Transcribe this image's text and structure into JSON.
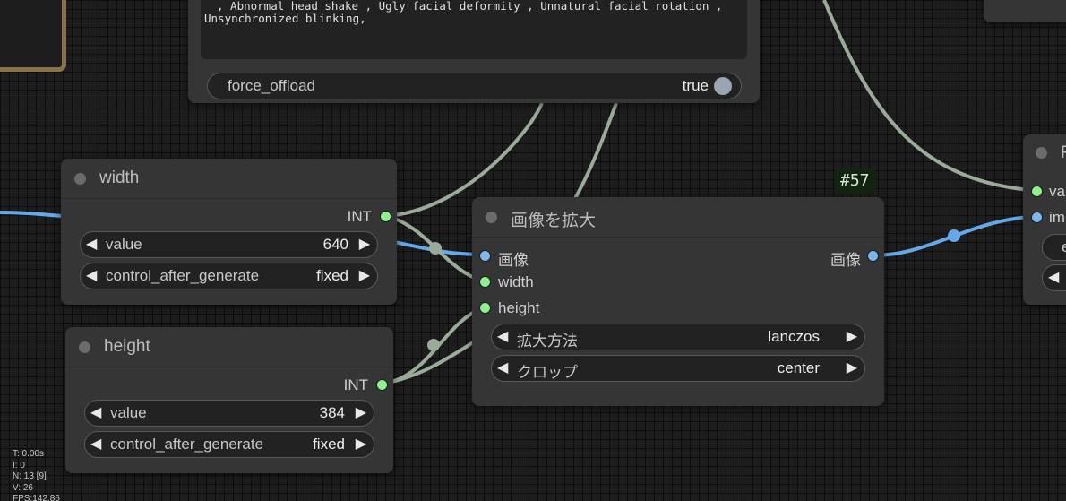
{
  "top_node": {
    "text_line1": ", Abnormal head shake , Ugly facial deformity , Unnatural facial rotation ,",
    "text_line2": "Unsynchronized blinking,",
    "toggle_label": "force_offload",
    "toggle_value": "true"
  },
  "width_node": {
    "title": "width",
    "output_type": "INT",
    "widgets": [
      {
        "name": "value",
        "value": "640"
      },
      {
        "name": "control_after_generate",
        "value": "fixed"
      }
    ]
  },
  "height_node": {
    "title": "height",
    "output_type": "INT",
    "widgets": [
      {
        "name": "value",
        "value": "384"
      },
      {
        "name": "control_after_generate",
        "value": "fixed"
      }
    ]
  },
  "upscale_node": {
    "badge": "#57",
    "title": "画像を拡大",
    "inputs": [
      "画像",
      "width",
      "height"
    ],
    "output_label": "画像",
    "widgets": [
      {
        "name": "拡大方法",
        "value": "lanczos"
      },
      {
        "name": "クロップ",
        "value": "center"
      }
    ]
  },
  "right_node": {
    "inputs": [
      "va",
      "im"
    ],
    "widget_fragment": "e"
  },
  "stats": {
    "t": "T: 0.00s",
    "i": "I: 0",
    "n": "N: 13 [9]",
    "v": "V: 26",
    "fps": "FPS:142.86"
  },
  "colors": {
    "link_image": "#64a8ea",
    "link_int": "#9aab9a",
    "int_slot": "#8ef08e",
    "image_slot": "#7ab8ee",
    "node_bg": "#353535",
    "canvas_bg": "#1d1d1d"
  }
}
